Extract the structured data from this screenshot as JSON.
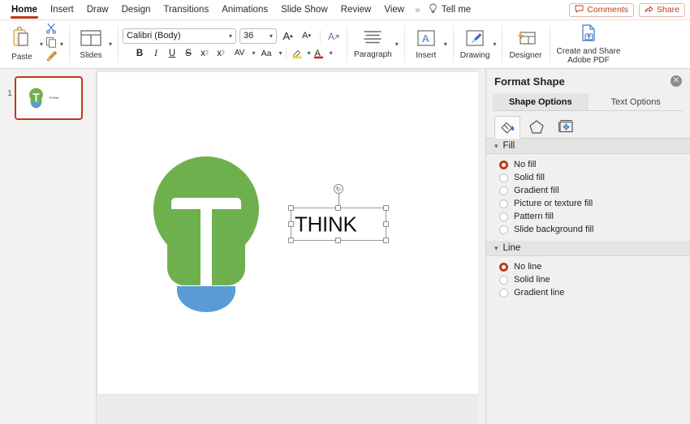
{
  "menubar": {
    "tabs": [
      {
        "label": "Home",
        "active": true
      },
      {
        "label": "Insert",
        "active": false
      },
      {
        "label": "Draw",
        "active": false
      },
      {
        "label": "Design",
        "active": false
      },
      {
        "label": "Transitions",
        "active": false
      },
      {
        "label": "Animations",
        "active": false
      },
      {
        "label": "Slide Show",
        "active": false
      },
      {
        "label": "Review",
        "active": false
      },
      {
        "label": "View",
        "active": false
      }
    ],
    "overflow": "»",
    "tell_me": "Tell me",
    "tell_me_icon": "lightbulb-icon",
    "comments": "Comments",
    "comments_icon": "comment-icon",
    "share": "Share",
    "share_icon": "share-icon",
    "accent_color": "#c0391b"
  },
  "ribbon": {
    "paste": {
      "label": "Paste",
      "icon": "clipboard-icon"
    },
    "cut": {
      "icon": "scissors-icon"
    },
    "copy": {
      "icon": "copy-icon"
    },
    "format_painter": {
      "icon": "format-painter-icon"
    },
    "slides": {
      "label": "Slides",
      "icon": "slide-layout-icon"
    },
    "font": {
      "name": "Calibri (Body)",
      "size": "36",
      "grow_font": "A",
      "shrink_font": "A",
      "clear_formatting": "A",
      "bold": "B",
      "italic": "I",
      "underline": "U",
      "strikethrough": "S",
      "superscript": "x",
      "subscript": "x",
      "character_spacing": "AV",
      "change_case": "Aa",
      "text_highlight": "A",
      "font_color": "A"
    },
    "paragraph": {
      "label": "Paragraph",
      "icon": "align-lines-icon"
    },
    "insert": {
      "label": "Insert",
      "icon": "text-box-icon"
    },
    "drawing": {
      "label": "Drawing",
      "icon": "brush-shape-icon"
    },
    "designer": {
      "label": "Designer",
      "icon": "designer-icon"
    },
    "adobe_pdf": {
      "label_line1": "Create and Share",
      "label_line2": "Adobe PDF",
      "icon": "pdf-upload-icon"
    }
  },
  "thumbnails": {
    "slides": [
      {
        "number": "1",
        "selected": true,
        "text": "THINK"
      }
    ]
  },
  "slide": {
    "shape_bulb": {
      "name": "lightbulb-graphic",
      "green": "#6FB04E",
      "blue": "#5B9BD5"
    },
    "textbox": {
      "text": "THINK",
      "selected": true,
      "rotation_icon": "rotate-icon"
    }
  },
  "format_pane": {
    "title": "Format Shape",
    "close_icon": "close-icon",
    "tabs": [
      {
        "label": "Shape Options",
        "active": true
      },
      {
        "label": "Text Options",
        "active": false
      }
    ],
    "icon_tabs": [
      {
        "name": "fill-bucket-icon",
        "active": true
      },
      {
        "name": "pentagon-effects-icon",
        "active": false
      },
      {
        "name": "size-layout-icon",
        "active": false
      }
    ],
    "sections": [
      {
        "title": "Fill",
        "expanded": true,
        "options": [
          {
            "label": "No fill",
            "selected": true
          },
          {
            "label": "Solid fill",
            "selected": false
          },
          {
            "label": "Gradient fill",
            "selected": false
          },
          {
            "label": "Picture or texture fill",
            "selected": false
          },
          {
            "label": "Pattern fill",
            "selected": false
          },
          {
            "label": "Slide background fill",
            "selected": false
          }
        ]
      },
      {
        "title": "Line",
        "expanded": true,
        "options": [
          {
            "label": "No line",
            "selected": true
          },
          {
            "label": "Solid line",
            "selected": false
          },
          {
            "label": "Gradient line",
            "selected": false
          }
        ]
      }
    ]
  }
}
